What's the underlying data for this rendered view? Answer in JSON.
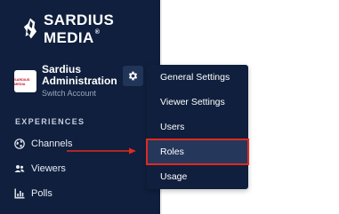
{
  "brand": {
    "name": "SARDIUS MEDIA",
    "trademark": "®",
    "icon": "sardius-logo-icon"
  },
  "account": {
    "avatar_text": "SARDIUS MEDIA",
    "name_line1": "Sardius",
    "name_line2": "Administration",
    "switch_label": "Switch Account",
    "settings_icon": "gear-icon"
  },
  "sidebar": {
    "section_label": "EXPERIENCES",
    "items": [
      {
        "label": "Channels",
        "icon": "globe-icon"
      },
      {
        "label": "Viewers",
        "icon": "users-icon"
      },
      {
        "label": "Polls",
        "icon": "bar-chart-icon"
      }
    ]
  },
  "dropdown": {
    "items": [
      {
        "label": "General Settings"
      },
      {
        "label": "Viewer Settings"
      },
      {
        "label": "Users"
      },
      {
        "label": "Roles",
        "highlighted": true
      },
      {
        "label": "Usage"
      }
    ]
  },
  "colors": {
    "sidebar_bg": "#0f1f3d",
    "highlight_border": "#e02a1e",
    "arrow": "#e02a1e"
  }
}
